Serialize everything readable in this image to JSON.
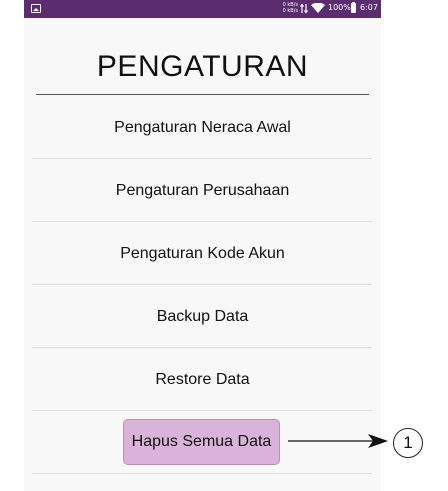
{
  "status_bar": {
    "net_speed_up": "0 kB/s",
    "net_speed_down": "0 kB/s",
    "battery": "100%",
    "time": "6:07",
    "icons": [
      "image-icon",
      "data-arrows-icon",
      "wifi-icon",
      "battery-icon"
    ]
  },
  "page": {
    "title": "PENGATURAN"
  },
  "menu": {
    "items": [
      {
        "label": "Pengaturan Neraca Awal"
      },
      {
        "label": "Pengaturan Perusahaan"
      },
      {
        "label": "Pengaturan Kode Akun"
      },
      {
        "label": "Backup Data"
      },
      {
        "label": "Restore Data"
      }
    ],
    "danger_button": {
      "label": "Hapus Semua Data",
      "color": "#d9b3d9"
    }
  },
  "annotation": {
    "badge_text": "1"
  },
  "colors": {
    "status_bar": "#5b2c6f",
    "background": "#f8f8f8"
  }
}
